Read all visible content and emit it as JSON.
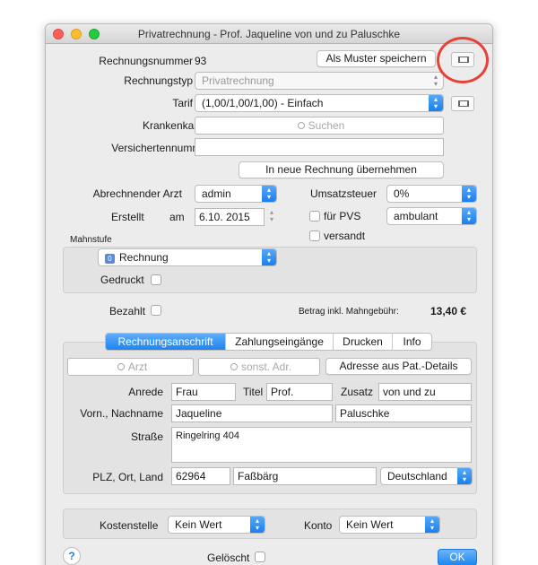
{
  "window": {
    "title": "Privatrechnung - Prof. Jaqueline von und zu Paluschke"
  },
  "invoice": {
    "number_label": "Rechnungsnummer",
    "number": "93",
    "template_button": "Als Muster speichern",
    "type_label": "Rechnungstyp",
    "type_value": "Privatrechnung",
    "tariff_label": "Tarif",
    "tariff_value": "(1,00/1,00/1,00)  - Einfach",
    "insurer_label": "Krankenkasse",
    "insurer_placeholder": "Suchen",
    "insured_number_label": "Versichertennummer",
    "insured_number_value": "",
    "transfer_button": "In neue Rechnung übernehmen"
  },
  "billing": {
    "doctor_label": "Abrechnender Arzt",
    "doctor_value": "admin",
    "vat_label": "Umsatzsteuer",
    "vat_value": "0%",
    "created_label": "Erstellt",
    "created_am": "am",
    "created_date": "6.10. 2015",
    "pvs_label": "für PVS",
    "mode_value": "ambulant",
    "sent_label": "versandt"
  },
  "dunning": {
    "section_label": "Mahnstufe",
    "level_badge": "0",
    "level_value": "Rechnung",
    "printed_label": "Gedruckt",
    "paid_label": "Bezahlt",
    "amount_label": "Betrag inkl. Mahngebühr:",
    "amount_value": "13,40 €"
  },
  "tabs": [
    "Rechnungsanschrift",
    "Zahlungseingänge",
    "Drucken",
    "Info"
  ],
  "address": {
    "doctor_search_placeholder": "Arzt",
    "other_search_placeholder": "sonst. Adr.",
    "from_patient_button": "Adresse aus Pat.-Details",
    "salutation_label": "Anrede",
    "salutation_value": "Frau",
    "title_label": "Titel",
    "title_value": "Prof.",
    "suffix_label": "Zusatz",
    "suffix_value": "von und zu",
    "name_label": "Vorn., Nachname",
    "first_name": "Jaqueline",
    "last_name": "Paluschke",
    "street_label": "Straße",
    "street_value": "Ringelring 404",
    "plz_label": "PLZ, Ort, Land",
    "plz_value": "62964",
    "city_value": "Faßbärg",
    "country_value": "Deutschland"
  },
  "footer": {
    "cost_center_label": "Kostenstelle",
    "cost_center_value": "Kein Wert",
    "account_label": "Konto",
    "account_value": "Kein Wert",
    "help_label": "?",
    "deleted_label": "Gelöscht",
    "ok_button": "OK"
  },
  "colors": {
    "accent": "#1e87f0",
    "highlight_circle": "#e8413a"
  }
}
